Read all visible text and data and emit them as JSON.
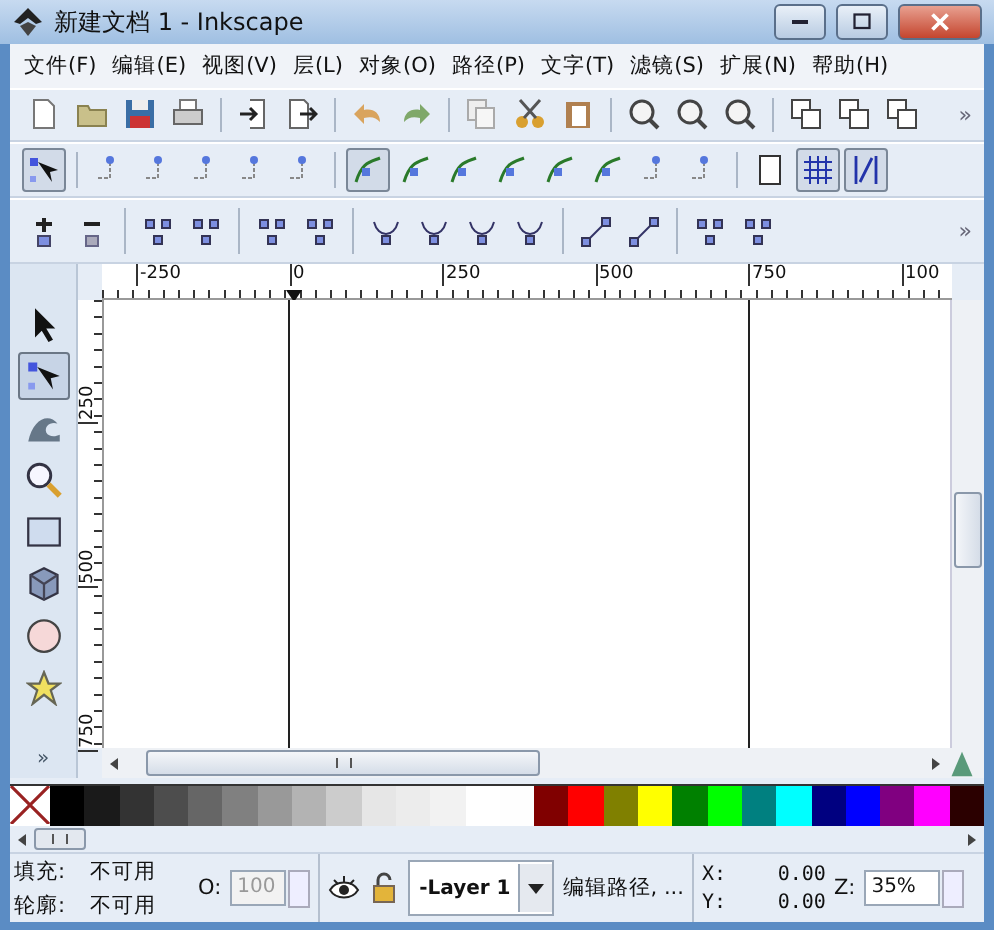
{
  "window": {
    "title": "新建文档 1 - Inkscape"
  },
  "menu": [
    "文件(F)",
    "编辑(E)",
    "视图(V)",
    "层(L)",
    "对象(O)",
    "路径(P)",
    "文字(T)",
    "滤镜(S)",
    "扩展(N)",
    "帮助(H)"
  ],
  "command_bar": {
    "overflow": "»"
  },
  "node_controls_bar": {
    "groups": [
      {
        "buttons": [
          {
            "selected": true
          }
        ]
      },
      {
        "buttons": [
          {
            "selected": false
          },
          {
            "selected": false
          },
          {
            "selected": false
          },
          {
            "selected": false
          },
          {
            "selected": false
          }
        ]
      },
      {
        "buttons": [
          {
            "selected": true
          },
          {
            "selected": false
          },
          {
            "selected": false
          },
          {
            "selected": false
          },
          {
            "selected": false
          },
          {
            "selected": false
          },
          {
            "selected": false
          },
          {
            "selected": false
          }
        ]
      },
      {
        "buttons": [
          {
            "selected": false
          },
          {
            "selected": true
          },
          {
            "selected": true
          }
        ]
      }
    ]
  },
  "node_edit_bar": {
    "overflow": "»"
  },
  "tools": [
    {
      "selected": false
    },
    {
      "selected": true
    },
    {
      "selected": false
    },
    {
      "selected": false
    },
    {
      "selected": false
    },
    {
      "selected": false
    },
    {
      "selected": false
    },
    {
      "selected": false
    }
  ],
  "toolbox_overflow": "»",
  "rulers": {
    "horizontal": [
      "-250",
      "0",
      "250",
      "500",
      "750",
      "100"
    ],
    "vertical": [
      "250",
      "500",
      "750"
    ]
  },
  "palette": {
    "swatches": [
      {
        "kind": "none"
      },
      {
        "kind": "color",
        "color": "#000000"
      },
      {
        "kind": "color",
        "color": "#1a1a1a"
      },
      {
        "kind": "color",
        "color": "#333333"
      },
      {
        "kind": "color",
        "color": "#4d4d4d"
      },
      {
        "kind": "color",
        "color": "#666666"
      },
      {
        "kind": "color",
        "color": "#808080"
      },
      {
        "kind": "color",
        "color": "#999999"
      },
      {
        "kind": "color",
        "color": "#b3b3b3"
      },
      {
        "kind": "color",
        "color": "#cccccc"
      },
      {
        "kind": "color",
        "color": "#e6e6e6"
      },
      {
        "kind": "color",
        "color": "#ececec"
      },
      {
        "kind": "color",
        "color": "#f2f2f2"
      },
      {
        "kind": "color",
        "color": "#ffffff"
      },
      {
        "kind": "color",
        "color": "#fefefe"
      },
      {
        "kind": "color",
        "color": "#800000"
      },
      {
        "kind": "color",
        "color": "#ff0000"
      },
      {
        "kind": "color",
        "color": "#808000"
      },
      {
        "kind": "color",
        "color": "#ffff00"
      },
      {
        "kind": "color",
        "color": "#008000"
      },
      {
        "kind": "color",
        "color": "#00ff00"
      },
      {
        "kind": "color",
        "color": "#008080"
      },
      {
        "kind": "color",
        "color": "#00ffff"
      },
      {
        "kind": "color",
        "color": "#000080"
      },
      {
        "kind": "color",
        "color": "#0000ff"
      },
      {
        "kind": "color",
        "color": "#800080"
      },
      {
        "kind": "color",
        "color": "#ff00ff"
      },
      {
        "kind": "color",
        "color": "#2b0000"
      }
    ]
  },
  "status": {
    "fill_label": "填充:",
    "fill_value": "不可用",
    "stroke_label": "轮廓:",
    "stroke_value": "不可用",
    "opacity_label": "O:",
    "opacity_value": "100",
    "opacity_disabled": true,
    "layer": "-Layer 1",
    "message": "编辑路径, ...",
    "x_label": "X:",
    "x_value": "0.00",
    "y_label": "Y:",
    "y_value": "0.00",
    "zoom_label": "Z:",
    "zoom_value": "35%"
  }
}
